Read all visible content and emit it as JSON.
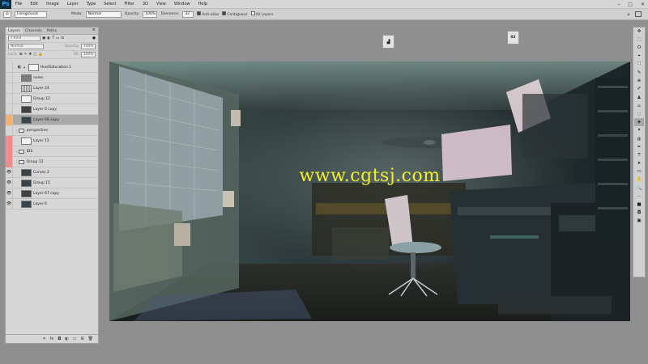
{
  "app": {
    "logo": "Ps"
  },
  "menu": [
    "File",
    "Edit",
    "Image",
    "Layer",
    "Type",
    "Select",
    "Filter",
    "3D",
    "View",
    "Window",
    "Help"
  ],
  "window_controls": [
    "–",
    "□",
    "✕"
  ],
  "options": {
    "preset": "Foreground",
    "mode_label": "Mode:",
    "mode_value": "Normal",
    "opacity_label": "Opacity:",
    "opacity_value": "100%",
    "tolerance_label": "Tolerance:",
    "tolerance_value": "32",
    "anti_alias": "Anti-alias",
    "contiguous": "Contiguous",
    "all_layers": "All Layers"
  },
  "layers_panel": {
    "tabs": [
      "Layers",
      "Channels",
      "Paths"
    ],
    "filter_kind": "Kind",
    "blend_mode": "Normal",
    "opacity_label": "Opacity:",
    "opacity_value": "100%",
    "lock_label": "Lock:",
    "fill_label": "Fill:",
    "fill_value": "100%",
    "layers": [
      {
        "name": "Hue/Saturation 1",
        "type": "adjustment",
        "eye": "",
        "mark": "none"
      },
      {
        "name": "noise",
        "type": "pixel-gray",
        "eye": "",
        "mark": "none"
      },
      {
        "name": "Layer 24",
        "type": "pixel-dots",
        "eye": "",
        "mark": "none"
      },
      {
        "name": "Group 12",
        "type": "pixel-light",
        "eye": "",
        "mark": "none"
      },
      {
        "name": "Layer 0 copy",
        "type": "pixel",
        "eye": "",
        "mark": "none"
      },
      {
        "name": "Layer 68 copy",
        "type": "pixel",
        "eye": "",
        "mark": "orange",
        "selected": true
      },
      {
        "name": "perspective",
        "type": "group",
        "eye": "",
        "mark": "none"
      },
      {
        "name": "Layer 15",
        "type": "pixel-light",
        "eye": "",
        "mark": "red"
      },
      {
        "name": "IDS",
        "type": "group",
        "eye": "",
        "mark": "red"
      },
      {
        "name": "Group 13",
        "type": "group",
        "eye": "",
        "mark": "red"
      },
      {
        "name": "Curves 2",
        "type": "pixel",
        "eye": "👁",
        "mark": "none"
      },
      {
        "name": "Group 15",
        "type": "pixel",
        "eye": "👁",
        "mark": "none"
      },
      {
        "name": "Layer 67 copy",
        "type": "pixel",
        "eye": "👁",
        "mark": "none"
      },
      {
        "name": "Layer 6",
        "type": "pixel",
        "eye": "👁",
        "mark": "none"
      }
    ],
    "bottom_icons": [
      "link-icon",
      "fx-icon",
      "mask-icon",
      "adjustment-icon",
      "folder-icon",
      "new-layer-icon",
      "trash-icon"
    ],
    "bottom_labels": [
      "⚭",
      "fx",
      "◘",
      "◐",
      "▭",
      "⊞",
      "🗑"
    ]
  },
  "canvas": {
    "watermark": "www.cgtsj.com"
  },
  "mini_panels": {
    "second_label": "02"
  },
  "tools": [
    "✥",
    "⬚",
    "ʘ",
    "⌖",
    "⛶",
    "✎",
    "⊕",
    "✐",
    "♟",
    "⌂",
    "◌",
    "◈",
    "✦",
    "◍",
    "✒",
    "T",
    "➤",
    "▭",
    "✋",
    "🔍",
    "⋯",
    "■",
    "◘",
    "▣"
  ]
}
